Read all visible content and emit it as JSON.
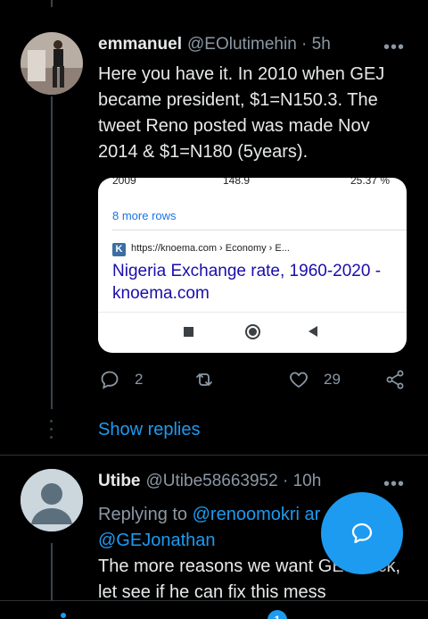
{
  "tweet1": {
    "display_name": "emmanuel",
    "handle": "@EOlutimehin",
    "time": "· 5h",
    "more": "•••",
    "text": "Here you have it. In 2010 when GEJ became president, $1=N150.3. The tweet Reno posted was made Nov 2014 & $1=N180 (5years).",
    "card": {
      "top_year": "2009",
      "top_value": "148.9",
      "top_pct": "25.37 %",
      "more_rows": "8 more rows",
      "logo_letter": "K",
      "url": "https://knoema.com › Economy › E...",
      "link_title": "Nigeria Exchange rate, 1960-2020 - knoema.com"
    },
    "actions": {
      "replies": "2",
      "retweets": "",
      "likes": "29"
    },
    "show_replies": "Show replies"
  },
  "tweet2": {
    "display_name": "Utibe",
    "handle": "@Utibe58663952",
    "time": "· 10h",
    "more": "•••",
    "replying_prefix": "Replying to",
    "mention1": "@renoomokri ar",
    "mention2": "@GEJonathan",
    "text": "The more reasons we want GEJ back, let see if he can fix this mess"
  },
  "bottom_bar": {
    "notification_badge": "1"
  },
  "colors": {
    "accent": "#1d9bf0",
    "background": "#000000",
    "muted": "#8b98a5"
  }
}
